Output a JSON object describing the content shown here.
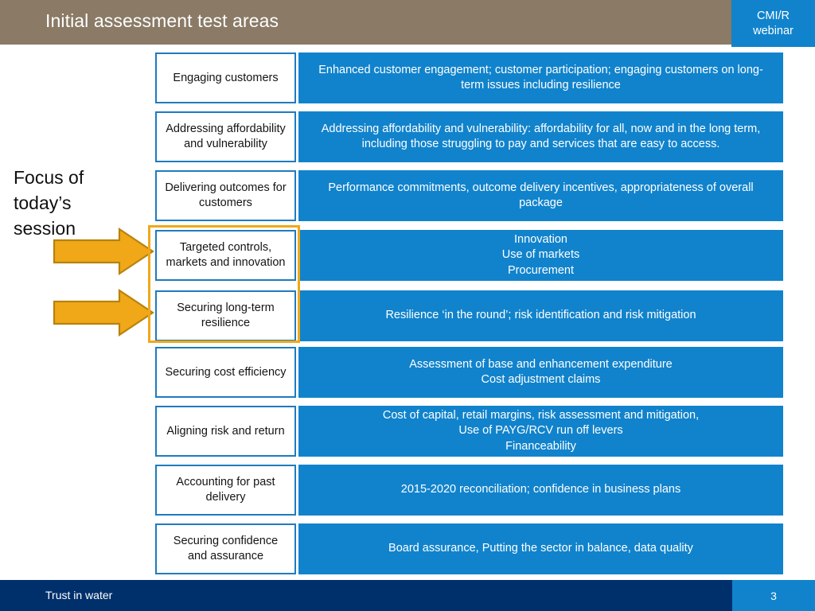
{
  "header": {
    "title": "Initial assessment test areas",
    "badge_line1": "CMI/R",
    "badge_line2": "webinar",
    "bar_color": "#8a7a66",
    "badge_color": "#1183cc"
  },
  "callout": {
    "label_line1": "Focus of",
    "label_line2": "today’s",
    "label_line3": "session",
    "arrow_color": "#f0a818",
    "arrow_border_color": "#b8820c",
    "highlight_color": "#f0a818"
  },
  "matrix": {
    "rows": [
      {
        "category": "Engaging customers",
        "description": "Enhanced customer engagement; customer participation; engaging customers on long-term issues including resilience",
        "highlighted": false
      },
      {
        "category": "Addressing affordability and vulnerability",
        "description": "Addressing affordability and vulnerability: affordability for all, now and in the long term, including those struggling to pay and services that are easy to access.",
        "highlighted": false
      },
      {
        "category": "Delivering outcomes for customers",
        "description": "Performance commitments, outcome delivery incentives, appropriateness of overall package",
        "highlighted": false
      },
      {
        "category": "Targeted controls, markets and innovation",
        "description": "Innovation\nUse of markets\nProcurement",
        "highlighted": true
      },
      {
        "category": "Securing long-term resilience",
        "description": "Resilience ‘in the round’; risk identification and risk mitigation",
        "highlighted": true
      },
      {
        "category": "Securing cost efficiency",
        "description": "Assessment of base and enhancement expenditure\nCost adjustment claims",
        "highlighted": false
      },
      {
        "category": "Aligning risk and return",
        "description": "Cost of capital, retail margins, risk assessment and mitigation,\nUse of PAYG/RCV run off levers\nFinanceability",
        "highlighted": false
      },
      {
        "category": "Accounting for past delivery",
        "description": "2015-2020 reconciliation; confidence in business plans",
        "highlighted": false
      },
      {
        "category": "Securing confidence and assurance",
        "description": "Board assurance, Putting the sector in balance, data quality",
        "highlighted": false
      }
    ],
    "category_border_color": "#1f7bbf",
    "description_fill_color": "#1183cc"
  },
  "footer": {
    "text": "Trust in water",
    "page_number": "3",
    "bar_color": "#00306b",
    "page_box_color": "#1183cc"
  }
}
